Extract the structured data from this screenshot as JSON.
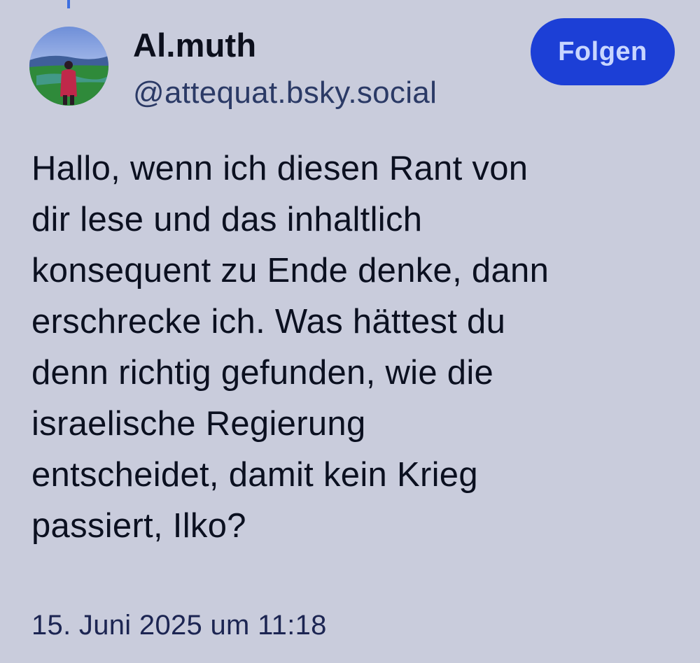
{
  "post": {
    "author": {
      "display_name": "Al.muth",
      "handle": "@attequat.bsky.social",
      "avatar": "avatar-landscape-person"
    },
    "follow_button_label": "Folgen",
    "text_lines": [
      "Hallo, wenn ich diesen Rant von",
      "dir lese und das inhaltlich",
      "konsequent zu Ende denke, dann",
      "erschrecke ich. Was hättest du",
      "denn richtig gefunden, wie die",
      "israelische Regierung",
      "entscheidet, damit kein Krieg",
      "passiert, Ilko?"
    ],
    "timestamp": "15. Juni 2025 um 11:18"
  },
  "colors": {
    "background": "#c9ccdc",
    "accent": "#1c3fd6",
    "thread_line": "#3d6fe0"
  }
}
